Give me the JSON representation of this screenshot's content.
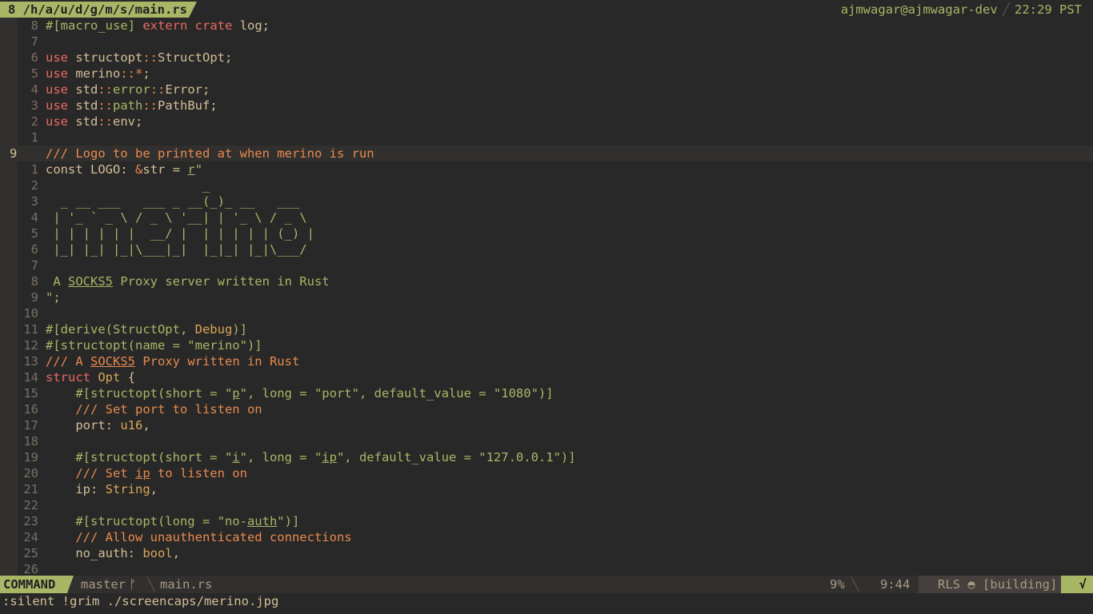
{
  "tabline": {
    "active_tab": "8 /h/a/u/d/g/m/s/main.rs",
    "host": "ajmwagar@ajmwagar-dev",
    "time": "22:29 PST"
  },
  "editor": {
    "cursor_line_number": "9",
    "line_numbers": [
      "8",
      "7",
      "6",
      "5",
      "4",
      "3",
      "2",
      "1",
      "9",
      "1",
      "2",
      "3",
      "4",
      "5",
      "6",
      "7",
      "8",
      "9",
      "10",
      "11",
      "12",
      "13",
      "14",
      "15",
      "16",
      "17",
      "18",
      "19",
      "20",
      "21",
      "22",
      "23",
      "24",
      "25",
      "26"
    ],
    "code": {
      "macro_use_attr": "#[macro_use]",
      "extern_kw": "extern",
      "crate_kw": "crate",
      "log_name": "log;",
      "use_kw": "use",
      "use1_a": "structopt",
      "use1_b": "StructOpt;",
      "use2_a": "merino",
      "use2_b": "*",
      "use3_a": "std",
      "use3_b": "error",
      "use3_c": "Error;",
      "use4_a": "std",
      "use4_b": "path",
      "use4_c": "PathBuf;",
      "use5_a": "std",
      "use5_b": "env;",
      "path_sep": "::",
      "doc_logo": "/// Logo to be printed at when merino is run",
      "const_kw": "const",
      "const_rest": "LOGO: ",
      "const_amp": "&",
      "const_str": "str",
      "const_eq": " = ",
      "raw_r": "r",
      "raw_quote": "\"",
      "ascii_1": "                     _",
      "ascii_2": "  _ __ ___   ___ _ __(_)_ __   ___",
      "ascii_3": " | '_ ` _ \\ / _ \\ '__| | '_ \\ / _ \\",
      "ascii_4": " | | | | | |  __/ |  | | | | | (_) |",
      "ascii_5": " |_| |_| |_|\\___|_|  |_|_| |_|\\___/",
      "desc_pre": " A ",
      "desc_socks": "SOCKS5",
      "desc_post": " Proxy server written in Rust",
      "raw_end": "\";",
      "derive_attr": "#[derive(StructOpt, ",
      "derive_debug": "Debug",
      "derive_close": ")]",
      "structopt_name": "#[structopt(name = \"merino\")]",
      "doc_a": "/// A ",
      "doc_socks": "SOCKS5",
      "doc_rest": " Proxy written in Rust",
      "struct_kw": "struct",
      "struct_name": "Opt",
      "brace_open": "{",
      "indent": "    ",
      "attr_port_1": "#[structopt(short = \"",
      "attr_port_p": "p",
      "attr_port_2": "\", long = \"port\", default_value = \"1080\")]",
      "doc_port": "/// Set port to listen on",
      "field_port": "port: ",
      "type_u16": "u16",
      "comma": ",",
      "attr_ip_1": "#[structopt(short = \"",
      "attr_ip_i": "i",
      "attr_ip_2": "\", long = \"",
      "attr_ip_ip": "ip",
      "attr_ip_3": "\", default_value = \"127.0.0.1\")]",
      "doc_ip_a": "/// Set ",
      "doc_ip_ip": "ip",
      "doc_ip_b": " to listen on",
      "field_ip": "ip: ",
      "type_string": "String",
      "attr_noauth_1": "#[structopt(long = \"no-",
      "attr_noauth_auth": "auth",
      "attr_noauth_2": "\")]",
      "doc_noauth": "/// Allow unauthenticated connections",
      "field_noauth": "no_auth: ",
      "type_bool": "bool"
    }
  },
  "statusline": {
    "mode": "COMMAND",
    "branch": "master",
    "branch_icon": "ᚠ",
    "file": "main.rs",
    "percent": "9%",
    "position": "9:44",
    "lsp": "RLS ◓ [building]",
    "check": "√"
  },
  "cmdline": ":silent !grim ./screencaps/merino.jpg",
  "colors": {
    "background": "#282828",
    "accent_green": "#a9b665",
    "keyword_red": "#ea6962",
    "comment_orange": "#e78a4e",
    "type_yellow": "#d8a657"
  }
}
